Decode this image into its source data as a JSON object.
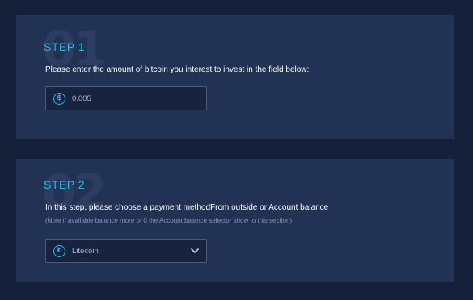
{
  "step1": {
    "number": "01",
    "title": "STEP 1",
    "instruction": "Please enter the amount of bitcoin you interest to invest in the field below:",
    "amount_field": {
      "value": "0.005",
      "icon": "bitcoin-coin-icon"
    }
  },
  "step2": {
    "number": "02",
    "title": "STEP 2",
    "instruction": "In this step, please choose a payment methodFrom outside or Account balance",
    "note": "(Note if available balance more of 0 the Account balance selector show to this section)",
    "payment_select": {
      "selected": "Litecoin",
      "icon": "litecoin-coin-icon"
    }
  },
  "colors": {
    "background": "#15203a",
    "card": "#223255",
    "accent": "#2ab4e8",
    "field_bg": "#17233f",
    "field_border": "#4a5b80"
  }
}
